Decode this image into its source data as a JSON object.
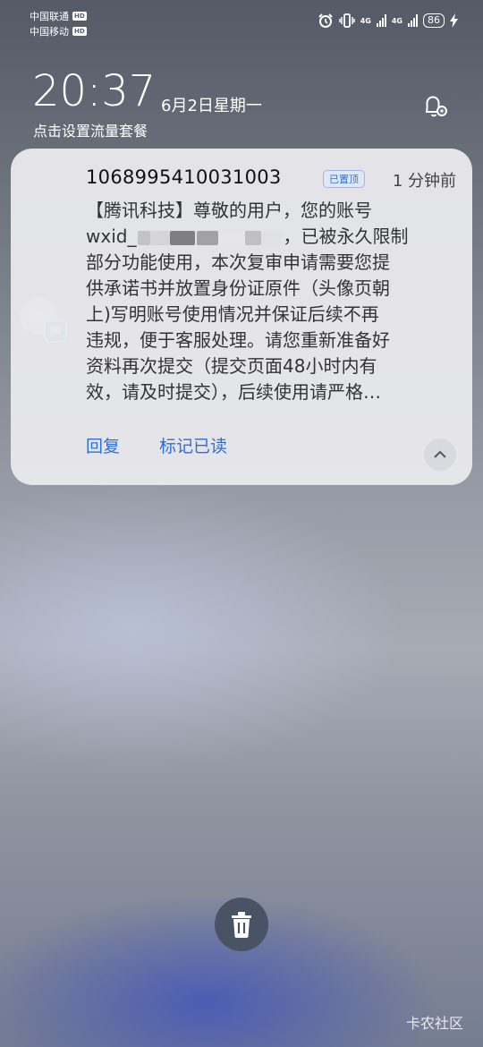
{
  "status_bar": {
    "carrier1": "中国联通",
    "carrier2": "中国移动",
    "hd_label": "HD",
    "network1": "4G",
    "network2": "4G",
    "battery": "86"
  },
  "lockscreen": {
    "time": "20:37",
    "date": "6月2日星期一",
    "data_plan": "点击设置流量套餐"
  },
  "notification": {
    "sender": "1068995410031003",
    "pinned_label": "已置顶",
    "time_ago": "1 分钟前",
    "lines": [
      "【腾讯科技】尊敬的用户，您的账号",
      "wxid_",
      "部分功能使用，本次复审申请需要您提",
      "供承诺书并放置身份证原件（头像页朝",
      "上)写明账号使用情况并保证后续不再",
      "违规，便于客服处理。请您重新准备好",
      "资料再次提交（提交页面48小时内有",
      "效，请及时提交），后续使用请严格…"
    ],
    "line2_tail": "，已被永久限制",
    "reply_label": "回复",
    "mark_read_label": "标记已读"
  },
  "watermark": "卡农社区"
}
